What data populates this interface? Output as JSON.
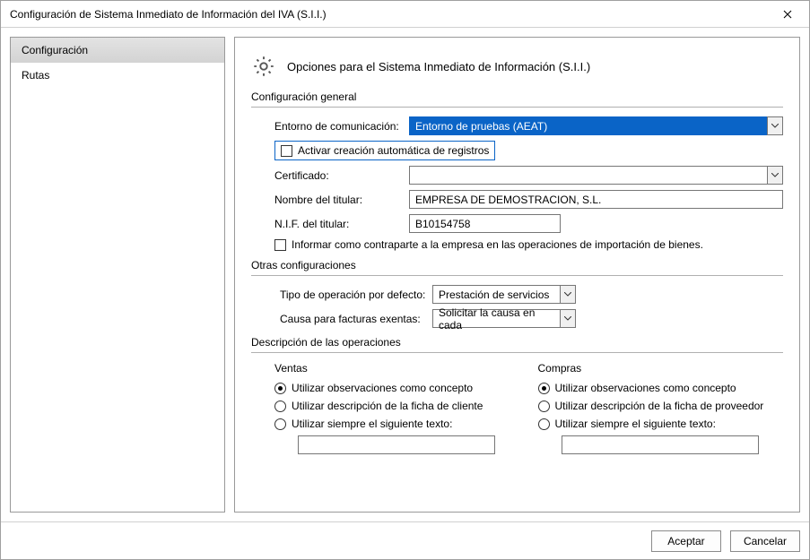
{
  "window": {
    "title": "Configuración de Sistema Inmediato de Información del IVA (S.I.I.)"
  },
  "sidebar": {
    "items": [
      {
        "label": "Configuración",
        "active": true
      },
      {
        "label": "Rutas",
        "active": false
      }
    ]
  },
  "page": {
    "title": "Opciones para el Sistema Inmediato de Información (S.I.I.)"
  },
  "general": {
    "group_header": "Configuración general",
    "env_label": "Entorno de comunicación:",
    "env_value": "Entorno de pruebas (AEAT)",
    "auto_create_label": "Activar creación automática de registros",
    "cert_label": "Certificado:",
    "cert_value": "",
    "holder_name_label": "Nombre del titular:",
    "holder_name_value": "EMPRESA DE DEMOSTRACION, S.L.",
    "holder_nif_label": "N.I.F. del titular:",
    "holder_nif_value": "B10154758",
    "counterparty_label": "Informar como contraparte a la empresa en las operaciones de importación de bienes."
  },
  "other": {
    "group_header": "Otras configuraciones",
    "op_type_label": "Tipo de operación por defecto:",
    "op_type_value": "Prestación de servicios",
    "exempt_cause_label": "Causa para facturas exentas:",
    "exempt_cause_value": "Solicitar la causa en cada"
  },
  "desc": {
    "group_header": "Descripción de las operaciones",
    "sales": {
      "header": "Ventas",
      "opt1": "Utilizar observaciones como concepto",
      "opt2": "Utilizar descripción de la ficha de cliente",
      "opt3": "Utilizar siempre el siguiente texto:",
      "text_value": ""
    },
    "purchases": {
      "header": "Compras",
      "opt1": "Utilizar observaciones como concepto",
      "opt2": "Utilizar descripción de la ficha de proveedor",
      "opt3": "Utilizar siempre el siguiente texto:",
      "text_value": ""
    }
  },
  "footer": {
    "ok": "Aceptar",
    "cancel": "Cancelar"
  }
}
